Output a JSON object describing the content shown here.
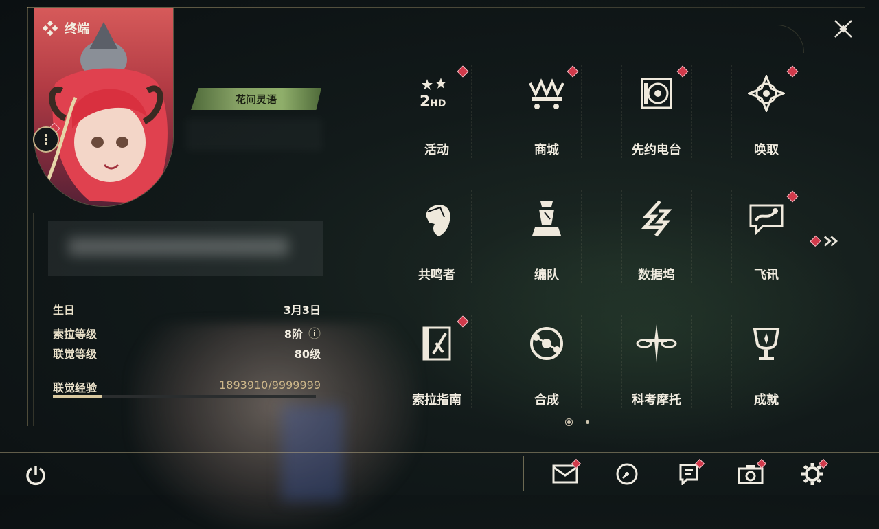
{
  "header": {
    "title": "终端"
  },
  "profile": {
    "title_plate": "花间灵语",
    "info": [
      {
        "label": "生日",
        "value": "3月3日"
      },
      {
        "label": "索拉等级",
        "value": "8阶"
      },
      {
        "label": "联觉等级",
        "value": "80级"
      }
    ],
    "exp": {
      "label": "联觉经验",
      "value": "1893910/9999999",
      "progress": 0.189
    }
  },
  "menu": {
    "items": [
      {
        "label": "活动",
        "icon": "event-2hd-icon",
        "badge": true
      },
      {
        "label": "商城",
        "icon": "shop-crown-icon",
        "badge": true
      },
      {
        "label": "先约电台",
        "icon": "radio-icon",
        "badge": true
      },
      {
        "label": "唤取",
        "icon": "convene-compass-icon",
        "badge": true
      },
      {
        "label": "共鸣者",
        "icon": "resonator-portrait-icon",
        "badge": false
      },
      {
        "label": "编队",
        "icon": "team-chess-icon",
        "badge": false
      },
      {
        "label": "数据坞",
        "icon": "databank-icon",
        "badge": false
      },
      {
        "label": "飞讯",
        "icon": "chat-message-icon",
        "badge": true
      },
      {
        "label": "索拉指南",
        "icon": "guidebook-icon",
        "badge": true
      },
      {
        "label": "合成",
        "icon": "synthesis-icon",
        "badge": false
      },
      {
        "label": "科考摩托",
        "icon": "motorcycle-icon",
        "badge": false
      },
      {
        "label": "成就",
        "icon": "trophy-icon",
        "badge": false
      }
    ],
    "page": {
      "current": 1,
      "total": 2
    }
  },
  "bottom_bar": {
    "icons": [
      {
        "name": "mail-icon",
        "badge": true
      },
      {
        "name": "clock-icon",
        "badge": false
      },
      {
        "name": "notice-icon",
        "badge": true
      },
      {
        "name": "camera-icon",
        "badge": true
      },
      {
        "name": "settings-gear-icon",
        "badge": true
      }
    ]
  },
  "colors": {
    "accent_gold": "#c9b48a",
    "badge_red": "#d13a4b",
    "text": "#f1ece0"
  }
}
